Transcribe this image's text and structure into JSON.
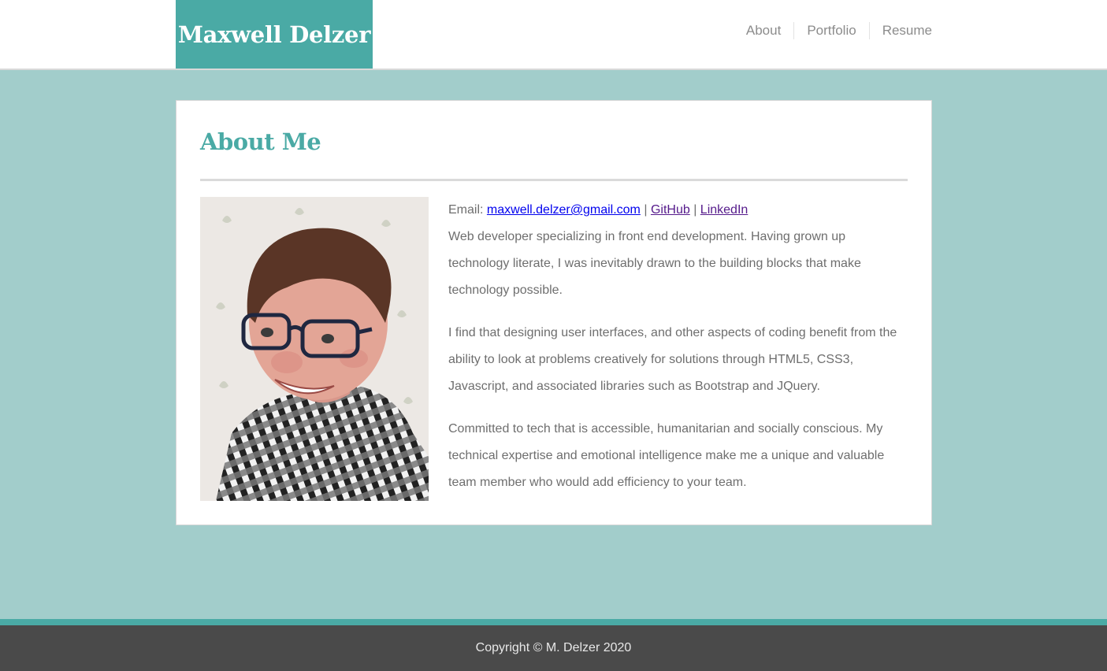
{
  "header": {
    "site_title": "Maxwell Delzer",
    "brand_color": "#4aaaa5",
    "nav": [
      {
        "label": "About"
      },
      {
        "label": "Portfolio"
      },
      {
        "label": "Resume"
      }
    ]
  },
  "about": {
    "title": "About Me",
    "photo_icon": "profile-photo",
    "email_label": "Email:",
    "email": "maxwell.delzer@gmail.com",
    "sep1": "|",
    "github": "GitHub",
    "sep2": "|",
    "linkedin": "LinkedIn",
    "paragraphs": [
      "Web developer specializing in front end development. Having grown up technology literate, I was inevitably drawn to the building blocks that make technology possible.",
      "I find that designing user interfaces, and other aspects of coding benefit from the ability to look at problems creatively for solutions through HTML5, CSS3, Javascript, and associated libraries such as Bootstrap and JQuery.",
      "Committed to tech that is accessible, humanitarian and socially conscious. My technical expertise and emotional intelligence make me a unique and valuable team member who would add efficiency to your team."
    ]
  },
  "footer": {
    "copyright": "Copyright © M. Delzer 2020"
  }
}
